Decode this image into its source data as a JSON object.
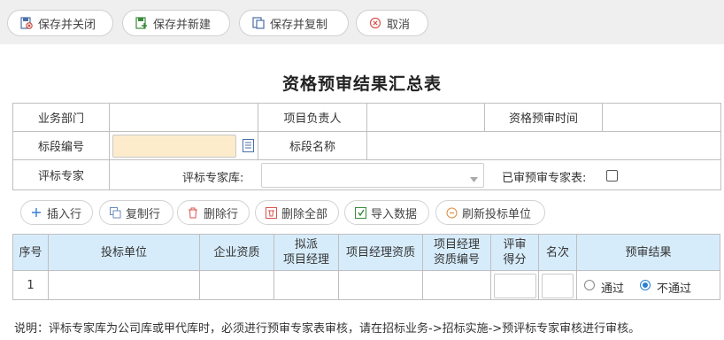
{
  "toolbar": {
    "save_close": "保存并关闭",
    "save_new": "保存并新建",
    "save_copy": "保存并复制",
    "cancel": "取消"
  },
  "form": {
    "title": "资格预审结果汇总表",
    "row1": {
      "dept_label": "业务部门",
      "manager_label": "项目负责人",
      "time_label": "资格预审时间"
    },
    "row2": {
      "section_no_label": "标段编号",
      "section_name_label": "标段名称"
    },
    "row3": {
      "expert_label": "评标专家",
      "library_label": "评标专家库:",
      "reviewed_label": "已审预审专家表:"
    }
  },
  "actions": {
    "insert_row": "插入行",
    "copy_row": "复制行",
    "delete_row": "删除行",
    "delete_all": "删除全部",
    "import_data": "导入数据",
    "refresh_units": "刷新投标单位"
  },
  "table": {
    "headers": {
      "seq": "序号",
      "bidder": "投标单位",
      "qualification": "企业资质",
      "pm_line1": "拟派",
      "pm_line2": "项目经理",
      "pm_qual": "项目经理资质",
      "pm_qual_no_line1": "项目经理",
      "pm_qual_no_line2": "资质编号",
      "score_line1": "评审",
      "score_line2": "得分",
      "rank": "名次",
      "result": "预审结果"
    },
    "rows": [
      {
        "seq": "1",
        "pass_label": "通过",
        "fail_label": "不通过",
        "selected": "fail"
      }
    ]
  },
  "note": "说明：评标专家库为公司库或甲代库时，必须进行预审专家表审核，请在招标业务->招标实施->预评标专家审核进行审核。",
  "colors": {
    "toolbar_bg": "#efefef",
    "header_bg": "#d7ecfb",
    "input_yellow": "#fdeccc",
    "radio_blue": "#2a7fd4"
  }
}
